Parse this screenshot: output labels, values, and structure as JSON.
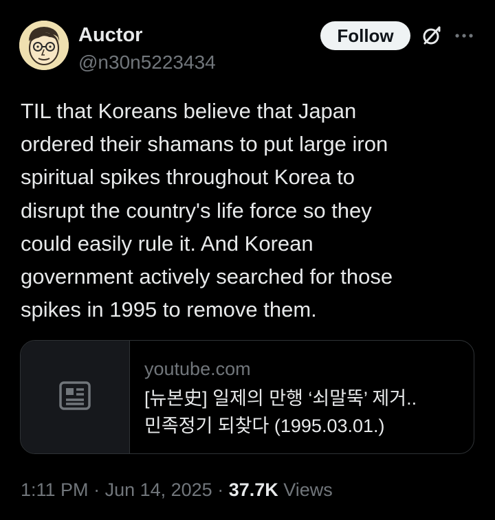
{
  "author": {
    "display_name": "Auctor",
    "handle": "@n30n5223434",
    "avatar_icon": "cartoon-face-with-glasses"
  },
  "actions": {
    "follow_label": "Follow",
    "grok_icon": "grok-icon",
    "more_icon": "more-horizontal-icon"
  },
  "tweet": {
    "text_lines": [
      "TIL that Koreans believe that Japan",
      "ordered their shamans to put large iron",
      "spiritual spikes throughout Korea to",
      "disrupt the country's life force so they",
      "could easily rule it. And Korean",
      "government actively searched for those",
      "spikes in 1995 to remove them."
    ]
  },
  "link_card": {
    "thumbnail_icon": "article-icon",
    "domain": "youtube.com",
    "title_lines": [
      "[뉴본史] 일제의 만행 ‘쇠말뚝’ 제거..",
      "민족정기 되찾다 (1995.03.01.)"
    ]
  },
  "meta": {
    "time": "1:11 PM",
    "separator": " · ",
    "date": "Jun 14, 2025",
    "views_count": "37.7K",
    "views_label": " Views"
  },
  "colors": {
    "background": "#000000",
    "text_primary": "#e7e9ea",
    "text_secondary": "#71767b",
    "border": "#2f3336",
    "follow_bg": "#eff3f4",
    "follow_text": "#0f1419"
  }
}
